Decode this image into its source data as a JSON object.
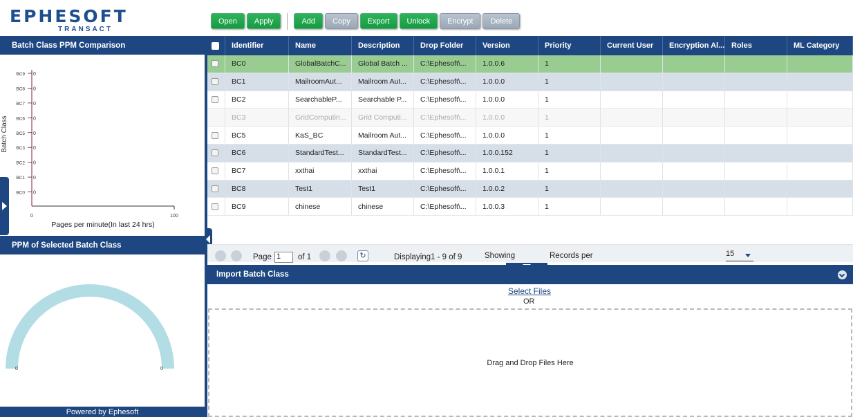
{
  "app": {
    "logo_main": "EPHESOFT",
    "logo_sub": "TRANSACT"
  },
  "toolbar": {
    "open": "Open",
    "apply": "Apply",
    "add": "Add",
    "copy": "Copy",
    "export": "Export",
    "unlock": "Unlock",
    "encrypt": "Encrypt",
    "delete": "Delete"
  },
  "left_panel": {
    "ppm_comparison_title": "Batch Class PPM Comparison",
    "ppm_selected_title": "PPM of Selected Batch Class",
    "footer": "Powered by Ephesoft"
  },
  "chart_data": [
    {
      "type": "bar",
      "orientation": "horizontal",
      "title": "",
      "xlabel": "Pages per minute(In last 24 hrs)",
      "ylabel": "Batch Class",
      "categories": [
        "BC0",
        "BC1",
        "BC2",
        "BC3",
        "BC5",
        "BC6",
        "BC7",
        "BC8",
        "BC9"
      ],
      "values": [
        0,
        0,
        0,
        0,
        0,
        0,
        0,
        0,
        0
      ],
      "value_labels": [
        "0",
        "0",
        "0",
        "0",
        "0",
        "0",
        "0",
        "0",
        "0"
      ],
      "xlim": [
        0,
        100
      ],
      "x_ticks": [
        "0",
        "100"
      ],
      "grid": false
    },
    {
      "type": "gauge",
      "value": 0,
      "min_label": "0",
      "max_label": "0",
      "color": "#b3dde4"
    }
  ],
  "grid": {
    "columns": [
      "Identifier",
      "Name",
      "Description",
      "Drop Folder",
      "Version",
      "Priority",
      "Current User",
      "Encryption Al...",
      "Roles",
      "ML Category"
    ],
    "rows": [
      {
        "id": "BC0",
        "name": "GlobalBatchC...",
        "desc": "Global Batch ...",
        "folder": "C:\\Ephesoft\\...",
        "version": "1.0.0.6",
        "priority": "1",
        "state": "selected"
      },
      {
        "id": "BC1",
        "name": "MailroomAut...",
        "desc": "Mailroom Aut...",
        "folder": "C:\\Ephesoft\\...",
        "version": "1.0.0.0",
        "priority": "1",
        "state": "alt"
      },
      {
        "id": "BC2",
        "name": "SearchableP...",
        "desc": "Searchable P...",
        "folder": "C:\\Ephesoft\\...",
        "version": "1.0.0.0",
        "priority": "1",
        "state": "normal"
      },
      {
        "id": "BC3",
        "name": "GridComputin...",
        "desc": "Grid Computi...",
        "folder": "C:\\Ephesoft\\...",
        "version": "1.0.0.0",
        "priority": "1",
        "state": "disabled"
      },
      {
        "id": "BC5",
        "name": "KaS_BC",
        "desc": "Mailroom Aut...",
        "folder": "C:\\Ephesoft\\...",
        "version": "1.0.0.0",
        "priority": "1",
        "state": "normal"
      },
      {
        "id": "BC6",
        "name": "StandardTest...",
        "desc": "StandardTest...",
        "folder": "C:\\Ephesoft\\...",
        "version": "1.0.0.152",
        "priority": "1",
        "state": "alt"
      },
      {
        "id": "BC7",
        "name": "xxthai",
        "desc": "xxthai",
        "folder": "C:\\Ephesoft\\...",
        "version": "1.0.0.1",
        "priority": "1",
        "state": "normal"
      },
      {
        "id": "BC8",
        "name": "Test1",
        "desc": "Test1",
        "folder": "C:\\Ephesoft\\...",
        "version": "1.0.0.2",
        "priority": "1",
        "state": "alt"
      },
      {
        "id": "BC9",
        "name": "chinese",
        "desc": "chinese",
        "folder": "C:\\Ephesoft\\...",
        "version": "1.0.0.3",
        "priority": "1",
        "state": "normal"
      }
    ]
  },
  "pager": {
    "page_label": "Page",
    "page_value": "1",
    "of_label": "of 1",
    "displaying": "Displaying1 - 9 of 9",
    "showing_label": "Showing",
    "per_page_value": "15",
    "records_label": "Records per"
  },
  "import_panel": {
    "title": "Import Batch Class",
    "select_files": "Select Files",
    "or": "OR",
    "drop_text": "Drag and Drop Files Here"
  }
}
